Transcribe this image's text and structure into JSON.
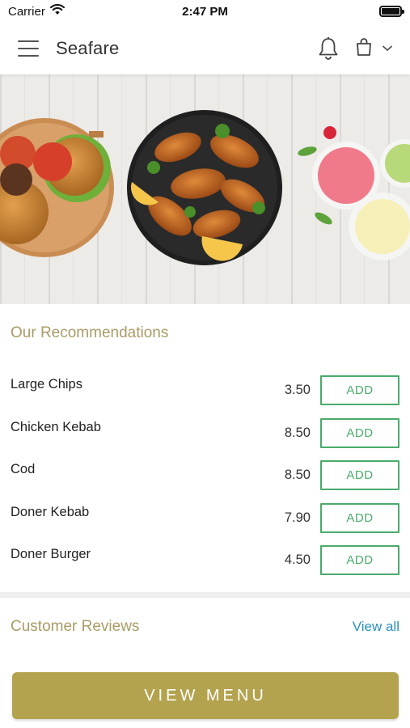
{
  "status_bar": {
    "carrier": "Carrier",
    "time": "2:47 PM",
    "battery_level": 1.0
  },
  "header": {
    "title": "Seafare",
    "icons": [
      "menu-icon",
      "bell-icon",
      "shopping-bag-icon",
      "chevron-down-icon"
    ]
  },
  "hero": {
    "image_description_icons": [
      "burger-board",
      "fried-chicken-plate",
      "dips-bowls"
    ]
  },
  "recommendations": {
    "title": "Our Recommendations",
    "items": [
      {
        "name": "Large Chips",
        "price": "3.50",
        "button": "ADD"
      },
      {
        "name": "Chicken Kebab",
        "price": "8.50",
        "button": "ADD"
      },
      {
        "name": "Cod",
        "price": "8.50",
        "button": "ADD"
      },
      {
        "name": "Doner Kebab",
        "price": "7.90",
        "button": "ADD"
      },
      {
        "name": "Doner Burger",
        "price": "4.50",
        "button": "ADD"
      }
    ]
  },
  "reviews": {
    "title": "Customer Reviews",
    "view_all": "View all"
  },
  "footer": {
    "view_menu": "VIEW MENU"
  },
  "colors": {
    "accent_gold": "#b4a34e",
    "section_title": "#a99c67",
    "add_green": "#4aab6b",
    "link_blue": "#2b8fc2"
  }
}
